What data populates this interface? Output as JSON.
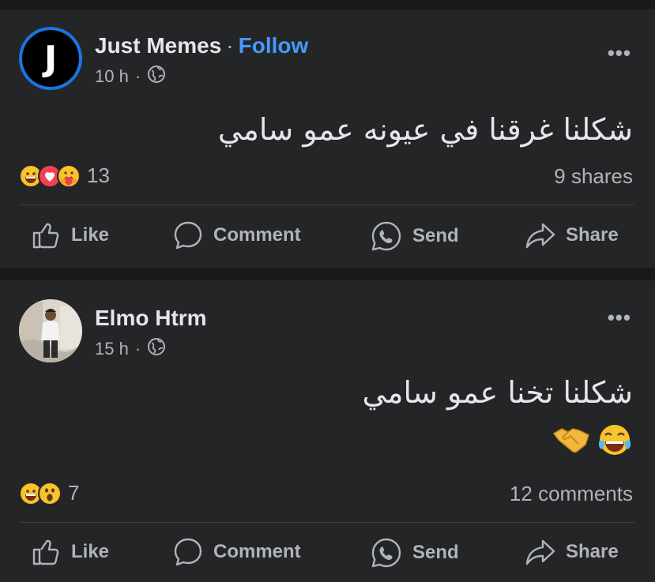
{
  "posts": [
    {
      "author": "Just Memes",
      "avatar_letter": "J",
      "follow_label": "Follow",
      "separator": "·",
      "time": "10 h",
      "meta_dot": "·",
      "more": "•••",
      "text_line1": "شكلنا غرقنا في عيونه عمو سامي",
      "reaction_count": "13",
      "reactions": [
        "grinning-face",
        "love-heart",
        "care-hug"
      ],
      "stat_right": "9 shares",
      "actions": {
        "like": "Like",
        "comment": "Comment",
        "send": "Send",
        "share": "Share"
      }
    },
    {
      "author": "Elmo Htrm",
      "time": "15 h",
      "meta_dot": "·",
      "more": "•••",
      "text_line1": "شكلنا تخنا عمو سامي",
      "text_emoji": [
        "tears-of-joy",
        "handshake"
      ],
      "reaction_count": "7",
      "reactions": [
        "grinning-face",
        "wow-face"
      ],
      "stat_right": "12 comments",
      "actions": {
        "like": "Like",
        "comment": "Comment",
        "send": "Send",
        "share": "Share"
      }
    }
  ],
  "colors": {
    "background": "#18191a",
    "card": "#242526",
    "primary_text": "#e4e6eb",
    "secondary_text": "#b0b3b8",
    "link_blue": "#4599ff",
    "avatar_ring": "#1b74e4",
    "divider": "#3e4042"
  }
}
